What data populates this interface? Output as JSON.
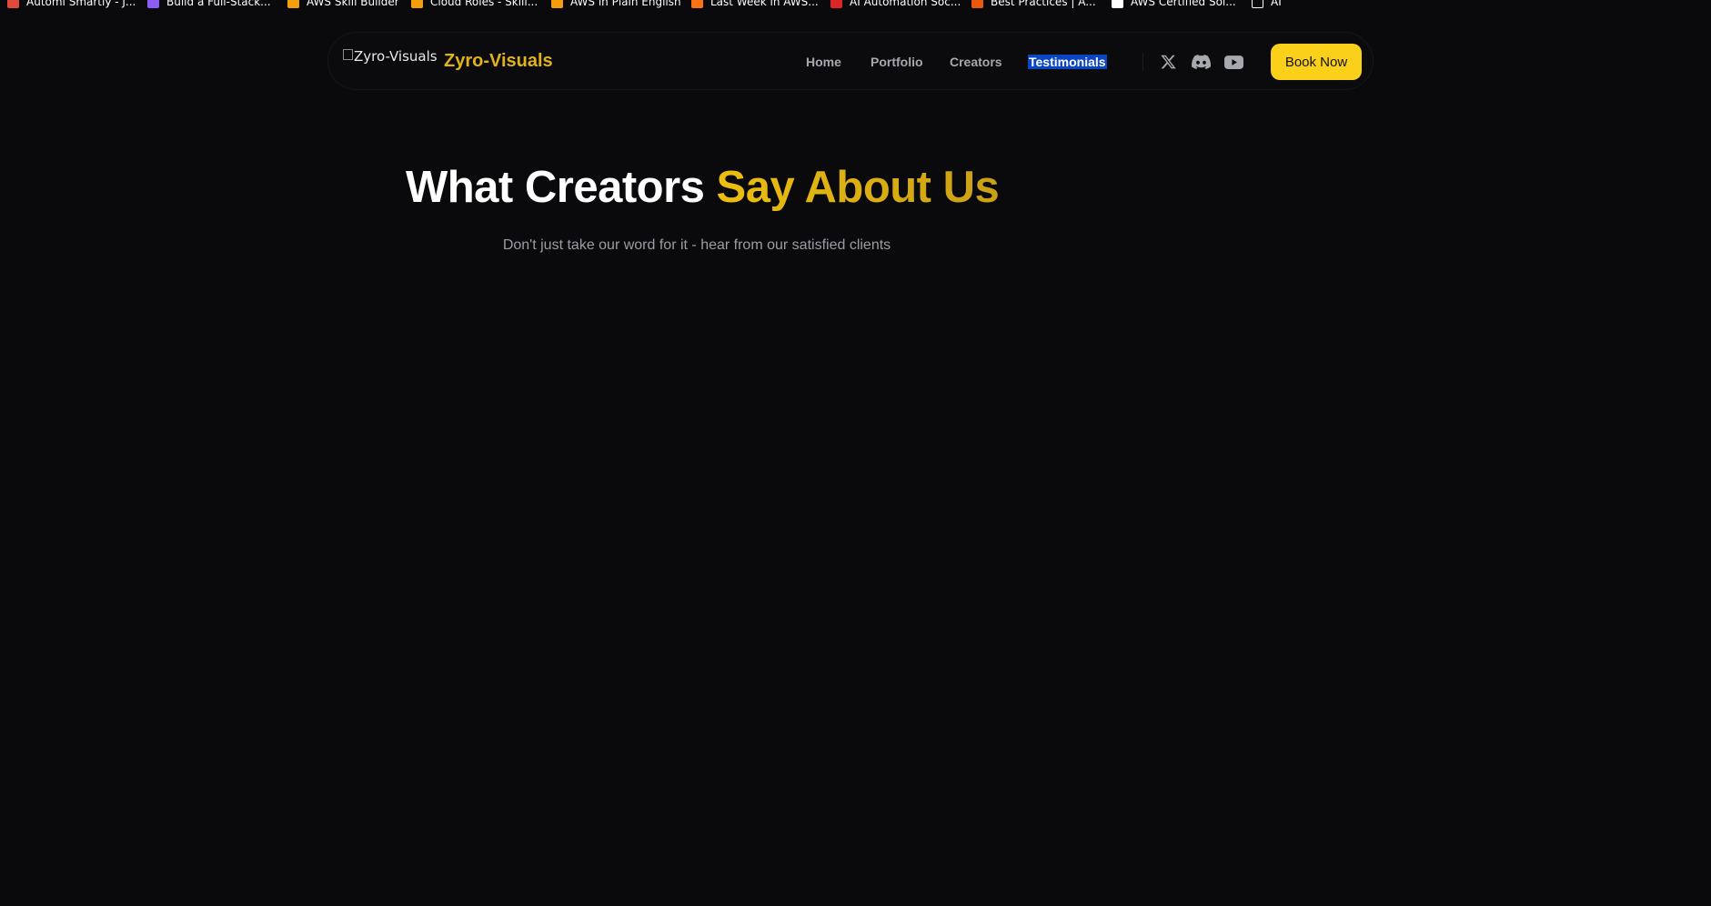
{
  "bookmarks": [
    {
      "label": "Automi Smartly - J...",
      "color": "#e04a3b"
    },
    {
      "label": "Build a Full-Stack...",
      "color": "#8b5cf6"
    },
    {
      "label": "AWS Skill Builder",
      "color": "#f59e0b"
    },
    {
      "label": "Cloud Roles - Skill...",
      "color": "#f59e0b"
    },
    {
      "label": "AWS in Plain English",
      "color": "#f59e0b"
    },
    {
      "label": "Last Week in AWS...",
      "color": "#f97316"
    },
    {
      "label": "AI Automation Soc...",
      "color": "#dc2626"
    },
    {
      "label": "Best Practices | A...",
      "color": "#ea580c"
    },
    {
      "label": "AWS Certified Sol...",
      "color": "#ffffff"
    },
    {
      "label": "AI",
      "color": "#ffffff"
    }
  ],
  "navbar": {
    "logo_alt": "Zyro-Visuals",
    "brand": "Zyro-Visuals",
    "links": [
      "Home",
      "Portfolio",
      "Creators",
      "Testimonials"
    ],
    "selected_link": "Testimonials",
    "social_icons": [
      "x-icon",
      "discord-icon",
      "youtube-icon"
    ],
    "cta_label": "Book Now"
  },
  "hero": {
    "title_part1": "What Creators",
    "title_part2": "Say About Us",
    "subtitle": "Don't just take our word for it - hear from our satisfied clients"
  },
  "colors": {
    "background": "#0a0a0d",
    "accent": "#fbd01a",
    "brand_text": "#e2b318",
    "nav_text": "#a7a8ad",
    "selection": "#0a46c4"
  }
}
